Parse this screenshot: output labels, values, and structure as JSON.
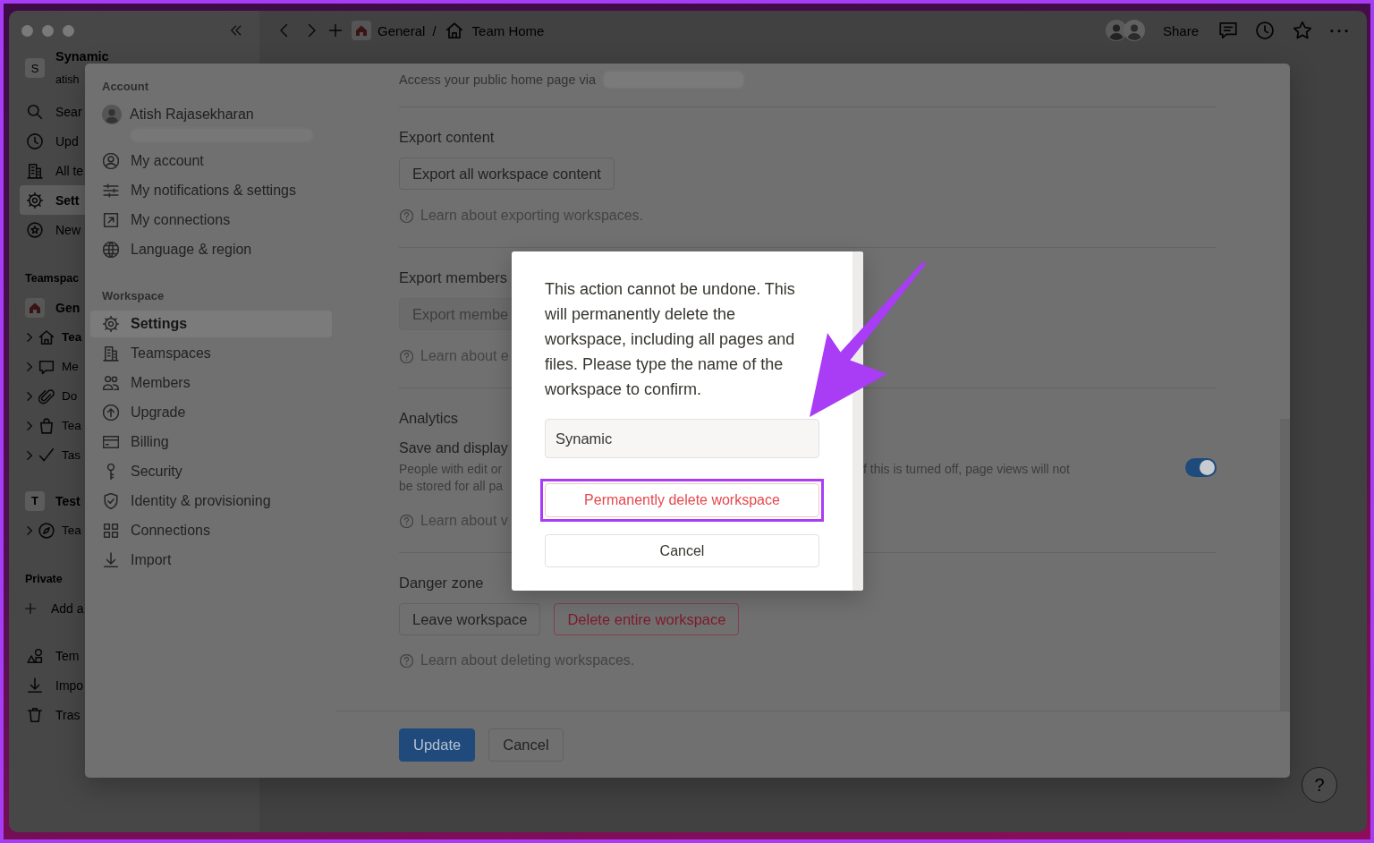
{
  "topbar": {
    "breadcrumb": {
      "items": [
        "General",
        "Team Home"
      ],
      "separator": "/"
    },
    "share": "Share"
  },
  "sidebar": {
    "workspace": {
      "initial": "S",
      "name": "Synamic",
      "email": "atish"
    },
    "items": [
      {
        "label": "Sear",
        "selected": false
      },
      {
        "label": "Upd",
        "selected": false
      },
      {
        "label": "All te",
        "selected": false
      },
      {
        "label": "Sett",
        "selected": true
      },
      {
        "label": "New",
        "selected": false
      }
    ],
    "teamspaces": {
      "title": "Teamspac",
      "spaces": [
        {
          "name": "Gen",
          "pages": [
            {
              "label": "Tea",
              "selected": true,
              "expanded": false
            },
            {
              "label": "Me",
              "selected": false,
              "expanded": false
            },
            {
              "label": "Do",
              "selected": false,
              "expanded": false
            },
            {
              "label": "Tea",
              "selected": false,
              "expanded": false
            },
            {
              "label": "Tas",
              "selected": false,
              "expanded": false
            }
          ]
        },
        {
          "initial": "T",
          "name": "Test",
          "pages": [
            {
              "label": "Tea",
              "selected": false,
              "expanded": false
            }
          ]
        }
      ]
    },
    "private": {
      "title": "Private",
      "items": [
        "Add a"
      ]
    },
    "footer_items": [
      "Tem",
      "Impo",
      "Tras"
    ]
  },
  "settings": {
    "nav": {
      "account_title": "Account",
      "user_name": "Atish Rajasekharan",
      "account_items": [
        {
          "label": "My account",
          "selected": false
        },
        {
          "label": "My notifications & settings",
          "selected": false
        },
        {
          "label": "My connections",
          "selected": false
        },
        {
          "label": "Language & region",
          "selected": false
        }
      ],
      "workspace_title": "Workspace",
      "workspace_items": [
        {
          "label": "Settings",
          "selected": true
        },
        {
          "label": "Teamspaces",
          "selected": false
        },
        {
          "label": "Members",
          "selected": false
        },
        {
          "label": "Upgrade",
          "selected": false
        },
        {
          "label": "Billing",
          "selected": false
        },
        {
          "label": "Security",
          "selected": false
        },
        {
          "label": "Identity & provisioning",
          "selected": false
        },
        {
          "label": "Connections",
          "selected": false
        },
        {
          "label": "Import",
          "selected": false
        }
      ]
    },
    "public_home": "Access your public home page via",
    "sections": [
      {
        "kind": "export",
        "title": "Export content",
        "button": {
          "label": "Export all workspace content",
          "disabled": false
        },
        "help": "Learn about exporting workspaces."
      },
      {
        "kind": "export",
        "title": "Export members",
        "button": {
          "label": "Export membe",
          "disabled": true
        },
        "help": "Learn about e"
      },
      {
        "kind": "toggle",
        "title": "Analytics",
        "label": "Save and display",
        "description_left": [
          "People with edit or",
          "be stored for all pa"
        ],
        "description_right": "f this is turned off, page views will not",
        "on": true,
        "help": "Learn about v"
      },
      {
        "kind": "actions",
        "title": "Danger zone",
        "buttons": [
          {
            "label": "Leave workspace",
            "kind": "default"
          },
          {
            "label": "Delete entire workspace",
            "kind": "danger"
          }
        ],
        "help": "Learn about deleting workspaces."
      }
    ],
    "footer": {
      "buttons": [
        {
          "label": "Update",
          "kind": "primary"
        },
        {
          "label": "Cancel",
          "kind": "default"
        }
      ]
    }
  },
  "confirm_dialog": {
    "message": "This action cannot be undone. This will permanently delete the workspace, including all pages and files. Please type the name of the workspace to confirm.",
    "input": {
      "value": "Synamic"
    },
    "buttons": [
      {
        "label": "Permanently delete workspace",
        "kind": "danger",
        "highlighted": true
      },
      {
        "label": "Cancel",
        "kind": "default",
        "highlighted": false
      }
    ]
  },
  "help_button": "?"
}
